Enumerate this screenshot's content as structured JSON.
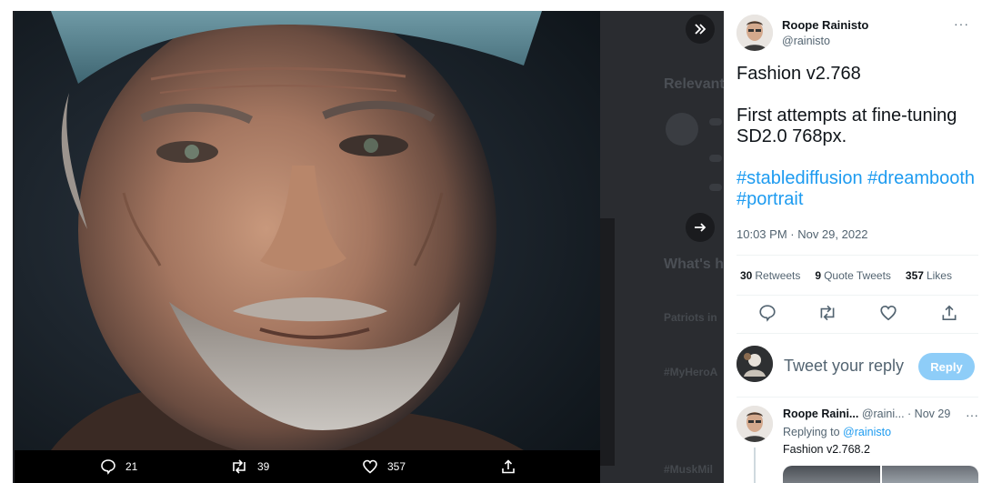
{
  "media_actions": {
    "reply_count": "21",
    "retweet_count": "39",
    "like_count": "357"
  },
  "background": {
    "heading_relevant": "Relevant",
    "heading_whats": "What's h",
    "trend_1": "Patriots in",
    "trend_2": "#MyHeroA",
    "trend_3": "#MuskMil"
  },
  "tweet": {
    "author_name": "Roope Rainisto",
    "author_handle": "@rainisto",
    "text_line1": "Fashion v2.768",
    "text_line2": "First attempts at fine-tuning SD2.0 768px.",
    "hashtags": "#stablediffusion #dreambooth #portrait",
    "timestamp": "10:03 PM · Nov 29, 2022",
    "retweets_count": "30",
    "retweets_label": "Retweets",
    "quote_count": "9",
    "quote_label": "Quote Tweets",
    "likes_count": "357",
    "likes_label": "Likes"
  },
  "reply_box": {
    "placeholder": "Tweet your reply",
    "button_label": "Reply"
  },
  "thread_reply": {
    "author_name": "Roope Raini...",
    "author_handle": "@raini...",
    "date": "· Nov 29",
    "replying_prefix": "Replying to",
    "replying_handle": "@rainisto",
    "text": "Fashion v2.768.2"
  },
  "icons": {
    "expand": "double-chevron-right-icon",
    "next": "arrow-right-icon",
    "reply": "speech-bubble-icon",
    "retweet": "retweet-icon",
    "like": "heart-icon",
    "share": "share-icon",
    "more": "ellipsis-icon"
  },
  "colors": {
    "accent": "#1d9bf0",
    "reply_button_disabled": "#8ecdf8",
    "muted_text": "#536471"
  }
}
